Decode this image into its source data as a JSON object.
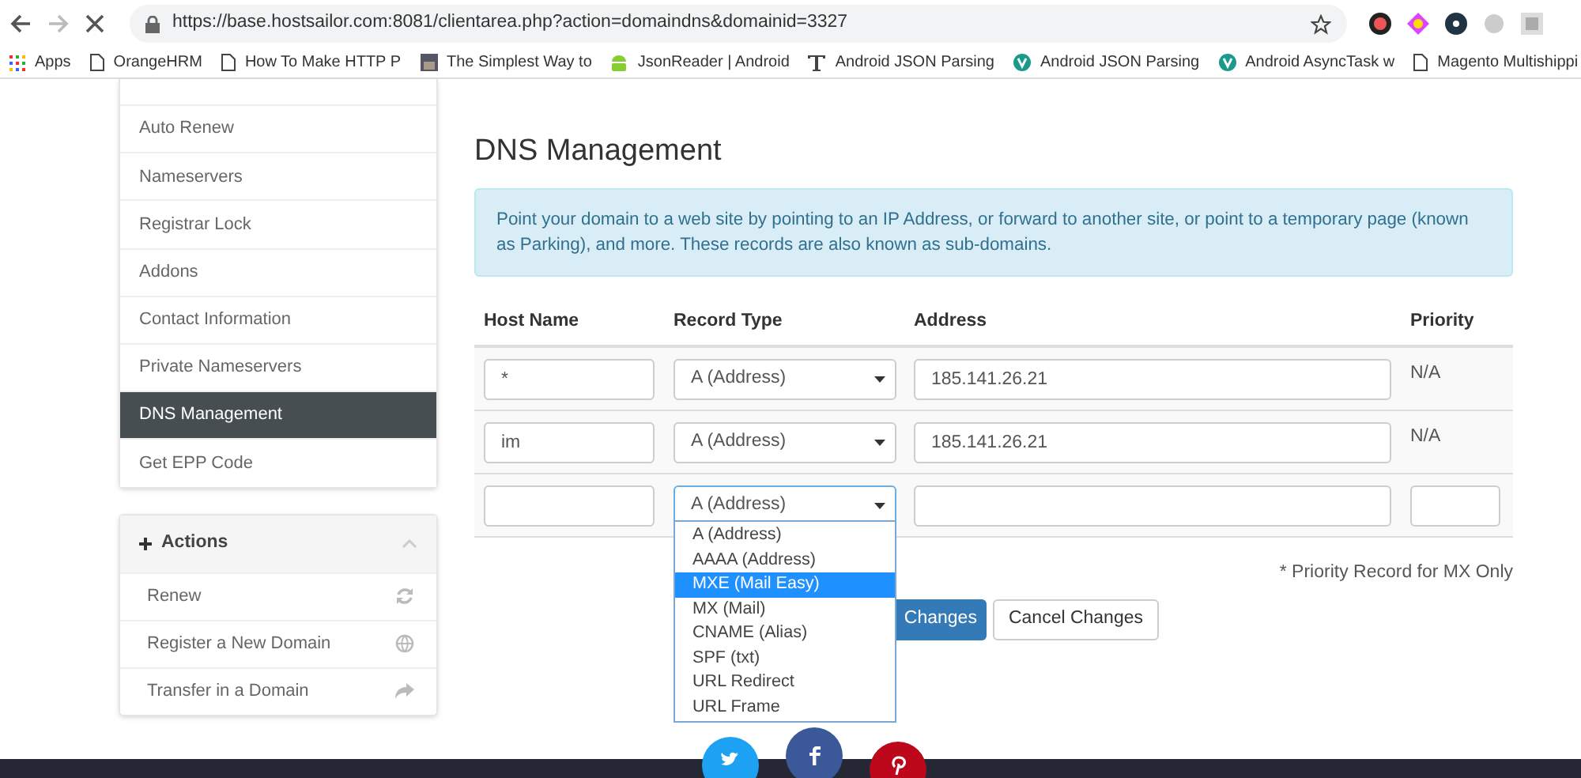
{
  "browser": {
    "url": "https://base.hostsailor.com:8081/clientarea.php?action=domaindns&domainid=3327",
    "bookmarks": [
      {
        "label": "Apps",
        "kind": "apps"
      },
      {
        "label": "OrangeHRM",
        "kind": "page"
      },
      {
        "label": "How To Make HTTP P",
        "kind": "page"
      },
      {
        "label": "The Simplest Way to",
        "kind": "photo"
      },
      {
        "label": "JsonReader | Android",
        "kind": "android"
      },
      {
        "label": "Android JSON Parsing",
        "kind": "letter"
      },
      {
        "label": "Android JSON Parsing",
        "kind": "leaf"
      },
      {
        "label": "Android AsyncTask w",
        "kind": "leaf"
      },
      {
        "label": "Magento Multishippi",
        "kind": "page"
      }
    ]
  },
  "sidebar": {
    "items": [
      {
        "label": "Auto Renew",
        "selected": false
      },
      {
        "label": "Nameservers",
        "selected": false
      },
      {
        "label": "Registrar Lock",
        "selected": false
      },
      {
        "label": "Addons",
        "selected": false
      },
      {
        "label": "Contact Information",
        "selected": false
      },
      {
        "label": "Private Nameservers",
        "selected": false
      },
      {
        "label": "DNS Management",
        "selected": true
      },
      {
        "label": "Get EPP Code",
        "selected": false
      }
    ]
  },
  "actions": {
    "title": "Actions",
    "expanded": true,
    "items": [
      {
        "label": "Renew"
      },
      {
        "label": "Register a New Domain"
      },
      {
        "label": "Transfer in a Domain"
      }
    ]
  },
  "page": {
    "title": "DNS Management",
    "info": "Point your domain to a web site by pointing to an IP Address, or forward to another site, or point to a temporary page (known as Parking), and more. These records are also known as sub-domains."
  },
  "table": {
    "columns": [
      "Host Name",
      "Record Type",
      "Address",
      "Priority"
    ],
    "rows": [
      {
        "kind": "record",
        "host": "*",
        "type": "A (Address)",
        "address": "185.141.26.21",
        "priority": "N/A",
        "open": false
      },
      {
        "kind": "record",
        "host": "im",
        "type": "A (Address)",
        "address": "185.141.26.21",
        "priority": "N/A",
        "open": false
      },
      {
        "kind": "new",
        "host": "",
        "type": "A (Address)",
        "address": "",
        "priority": "",
        "open": true
      }
    ]
  },
  "dropdown": {
    "options": [
      {
        "label": "A (Address)",
        "selected": false
      },
      {
        "label": "AAAA (Address)",
        "selected": false
      },
      {
        "label": "MXE (Mail Easy)",
        "selected": true
      },
      {
        "label": "MX (Mail)",
        "selected": false
      },
      {
        "label": "CNAME (Alias)",
        "selected": false
      },
      {
        "label": "SPF (txt)",
        "selected": false
      },
      {
        "label": "URL Redirect",
        "selected": false
      },
      {
        "label": "URL Frame",
        "selected": false
      }
    ]
  },
  "note": "* Priority Record for MX Only",
  "buttons": {
    "save": "Changes",
    "cancel": "Cancel Changes"
  }
}
